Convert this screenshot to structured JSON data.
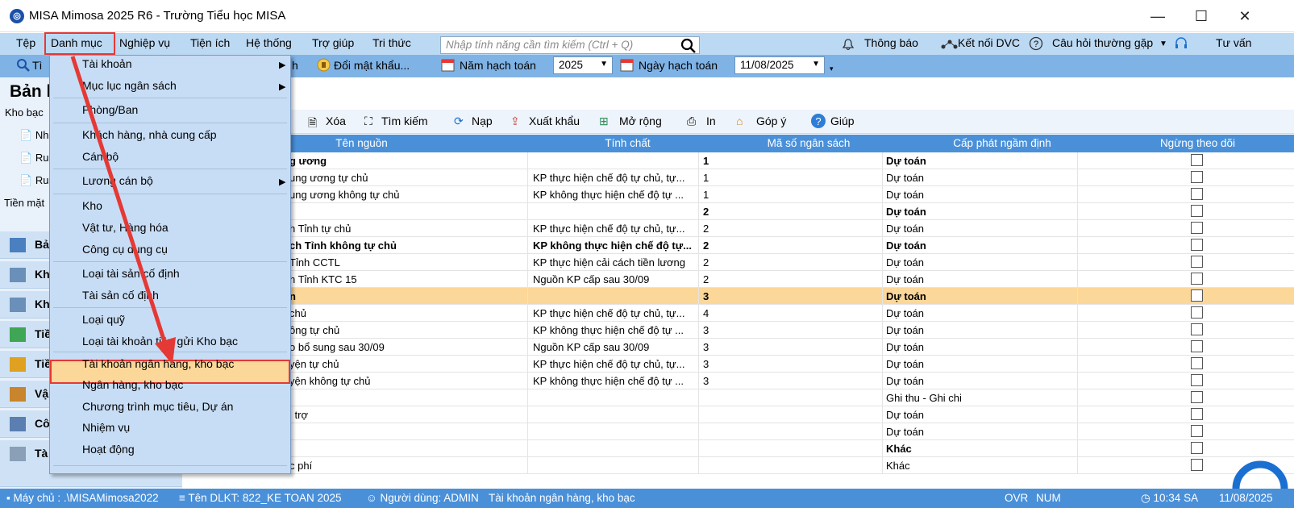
{
  "window": {
    "title": "MISA Mimosa 2025 R6 - Trường Tiểu học MISA",
    "min": "—",
    "max": "☐",
    "close": "✕"
  },
  "menubar": {
    "items": [
      "Tệp",
      "Danh mục",
      "Nghiệp vụ",
      "Tiện ích",
      "Hệ thống",
      "Trợ giúp",
      "Tri thức"
    ],
    "search_placeholder": "Nhập tính năng cần tìm kiếm (Ctrl + Q)",
    "notify": "Thông báo",
    "dvc": "Kết nối DVC",
    "faq": "Câu hỏi thường gặp",
    "consult": "Tư vấn"
  },
  "toolbar2": {
    "search_short": "Tì",
    "partial": "h",
    "change_password": "Đổi mật khẩu...",
    "fiscal_year_label": "Năm hạch toán",
    "fiscal_year": "2025",
    "posting_date_label": "Ngày hạch toán",
    "posting_date": "11/08/2025"
  },
  "left": {
    "title": "Bản l",
    "subtitle": "Kho bạc",
    "links": [
      "Nh",
      "Ru",
      "Ru"
    ],
    "cash_label": "Tiền mặt",
    "side_buttons": [
      "Bả",
      "Kh",
      "Kh",
      "Tiề",
      "Tiề",
      "Vậ",
      "Cô",
      "Tà"
    ]
  },
  "toolbar3": {
    "delete": "Xóa",
    "search": "Tìm kiếm",
    "reload": "Nạp",
    "export": "Xuất khẩu",
    "expand": "Mở rộng",
    "print": "In",
    "feedback": "Góp ý",
    "help": "Giúp"
  },
  "table": {
    "columns": [
      "Tên nguồn",
      "Tính chất",
      "Mã số ngân sách",
      "Cấp phát ngầm định",
      "Ngừng theo dõi"
    ],
    "rows": [
      {
        "name": "g ương",
        "nature": "",
        "code": "1",
        "alloc": "Dự toán",
        "bold": true
      },
      {
        "name": "ung ương tự chủ",
        "nature": "KP thực hiện chế độ tự chủ, tự...",
        "code": "1",
        "alloc": "Dự toán",
        "bold": false
      },
      {
        "name": "ung ương không tự chủ",
        "nature": "KP không thực hiện chế độ tự ...",
        "code": "1",
        "alloc": "Dự toán",
        "bold": false
      },
      {
        "name": "",
        "nature": "",
        "code": "2",
        "alloc": "Dự toán",
        "bold": true
      },
      {
        "name": "h Tỉnh tự chủ",
        "nature": "KP thực hiện chế độ tự chủ, tự...",
        "code": "2",
        "alloc": "Dự toán",
        "bold": false
      },
      {
        "name": "ch Tỉnh không tự chủ",
        "nature": "KP không thực hiện chế độ tự...",
        "code": "2",
        "alloc": "Dự toán",
        "bold": true
      },
      {
        "name": "Tỉnh CCTL",
        "nature": "KP thực hiện cải cách tiền lương",
        "code": "2",
        "alloc": "Dự toán",
        "bold": false
      },
      {
        "name": "h Tỉnh KTC 15",
        "nature": "Nguồn KP cấp sau 30/09",
        "code": "2",
        "alloc": "Dự toán",
        "bold": false
      },
      {
        "name": "n",
        "nature": "",
        "code": "3",
        "alloc": "Dự toán",
        "bold": true,
        "selected": true
      },
      {
        "name": "chủ",
        "nature": "KP thực hiện chế độ tự chủ, tự...",
        "code": "4",
        "alloc": "Dự toán",
        "bold": false
      },
      {
        "name": "ông tự chủ",
        "nature": "KP không thực hiện chế độ tự ...",
        "code": "3",
        "alloc": "Dự toán",
        "bold": false
      },
      {
        "name": "o bổ sung sau 30/09",
        "nature": "Nguồn KP cấp sau 30/09",
        "code": "3",
        "alloc": "Dự toán",
        "bold": false
      },
      {
        "name": "yện tự chủ",
        "nature": "KP thực hiện chế độ tự chủ, tự...",
        "code": "3",
        "alloc": "Dự toán",
        "bold": false
      },
      {
        "name": "yện không tự chủ",
        "nature": "KP không thực hiện chế độ tự ...",
        "code": "3",
        "alloc": "Dự toán",
        "bold": false
      },
      {
        "name": "",
        "nature": "",
        "code": "",
        "alloc": "Ghi thu - Ghi chi",
        "bold": false
      },
      {
        "name": "i trợ",
        "nature": "",
        "code": "",
        "alloc": "Dự toán",
        "bold": false
      },
      {
        "name": "",
        "nature": "",
        "code": "",
        "alloc": "Dự toán",
        "bold": false
      },
      {
        "name": "",
        "nature": "",
        "code": "",
        "alloc": "Khác",
        "bold": true
      },
      {
        "name": "c phí",
        "nature": "",
        "code": "",
        "alloc": "Khác",
        "bold": false
      }
    ]
  },
  "dropdown": {
    "items": [
      "Tài khoản",
      "Mục lục ngân sách",
      "Phòng/Ban",
      "Khách hàng, nhà cung cấp",
      "Cán bộ",
      "Lương cán bộ",
      "Kho",
      "Vật tư, Hàng hóa",
      "Công cụ dụng cụ",
      "Loại tài sản cố định",
      "Tài sản cố định",
      "Loại quỹ",
      "Loại tài khoản tiền gửi Kho bạc",
      "Tài khoản ngân hàng, kho bạc",
      "Ngân hàng, kho bạc",
      "Chương trình mục tiêu, Dự án",
      "Nhiệm vụ",
      "Hoạt động"
    ]
  },
  "status": {
    "server": "Máy chủ : .\\MISAMimosa2022",
    "db": "Tên DLKT: 822_KE TOAN 2025",
    "user": "Người dùng: ADMIN",
    "screen": "Tài khoản ngân hàng, kho bạc",
    "ovr": "OVR",
    "num": "NUM",
    "time": "10:34 SA",
    "date": "11/08/2025"
  },
  "colors": {
    "accent": "#4a90d9",
    "highlight": "#fbd79a",
    "annotation": "#e53935",
    "menubar": "#bcd9f3"
  }
}
